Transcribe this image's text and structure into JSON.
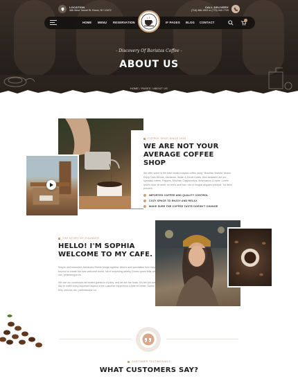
{
  "topbar": {
    "location_label": "LOCATION",
    "location_value": "466 West Tunnel St. Bronx, NY 10472",
    "delivery_label": "CALL DELIVERY",
    "delivery_value": "(718) 466-1902 or (770) 942-7729"
  },
  "nav": {
    "items": [
      "HOME",
      "MENU",
      "RESERVATION",
      "IF PAGES",
      "BLOG",
      "CONTACT"
    ]
  },
  "hero": {
    "subtitle": "- Discovery Of Baristas Coffee -",
    "title": "ABOUT US",
    "breadcrumb": "HOME / PAGES / ABOUT US"
  },
  "about": {
    "kicker": "COFFEE SHOP SINCE 1950",
    "title_line1": "WE ARE NOT YOUR",
    "title_line2": "AVERAGE COFFEE SHOP",
    "body": "We offer some of the best locally-roasted coffee using \"Brazilian Barista\" beans. Enjoy Dark Blends, Jamaican, Italian & Decaf roasts. Also available are our specialty Lattes, Frappes, Mochas, Cappuccinos, Americanos & more. Lorem ipsum dolor sit amet, eu fermi audi sce, nec ut feugiat aliquam volutpat. Tot lbero posuere.",
    "features": [
      "IMPORTED COFFEE AND QUALITY CONTROL",
      "COZY SPACE TO ENJOY AND RELAX",
      "MAKE SURE THE COFFEE TASTE DOESN'T CHANGE"
    ]
  },
  "story": {
    "kicker": "THE STORY OF FOUNDER",
    "title_line1": "HELLO! I'M SOPHIA",
    "title_line2": "WELCOME TO MY CAFE.",
    "para1": "Simple and balanced. Alexandra Riehle brings together flavors and specialties from Italy and beyond to create the ever-welcome world, full of surprising artistry. Donec quam felis, ultricies nec, pellentesque eu.",
    "para2": "We use our cookbooks as invited guests to a party, and we are the hosts. It's her job every day to make every important aspect of the customer experience a little bit better. Donec quam felis, ultricies nec, pellentesque eu."
  },
  "testimonials": {
    "kicker": "CUSTOMER TESTIMONIALS",
    "title": "WHAT CUSTOMERS SAY?"
  },
  "colors": {
    "accent": "#c9a37c",
    "dark": "#1c1b1a",
    "hero_bg": "#2b241f"
  }
}
